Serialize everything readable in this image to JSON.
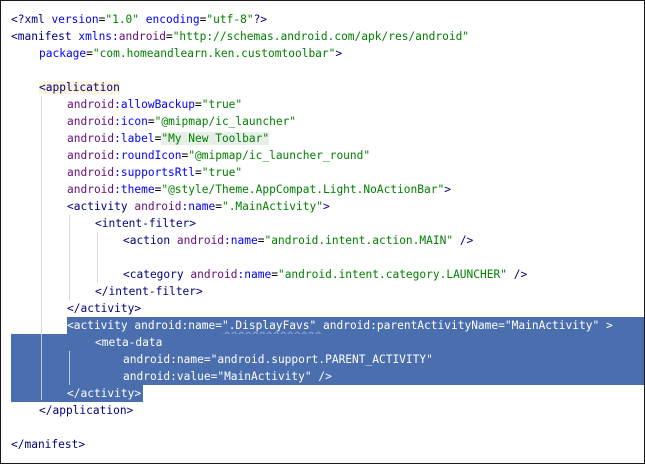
{
  "editor": {
    "lines": [
      {
        "id": "l1",
        "segments": [
          {
            "t": "<?",
            "c": "tag"
          },
          {
            "t": "xml ",
            "c": "tag"
          },
          {
            "t": "version",
            "c": "attr"
          },
          {
            "t": "=",
            "c": "plain"
          },
          {
            "t": "\"1.0\" ",
            "c": "val"
          },
          {
            "t": "encoding",
            "c": "attr"
          },
          {
            "t": "=",
            "c": "plain"
          },
          {
            "t": "\"utf-8\"",
            "c": "val"
          },
          {
            "t": "?>",
            "c": "tag"
          }
        ]
      },
      {
        "id": "l2",
        "segments": [
          {
            "t": "<manifest ",
            "c": "tag"
          },
          {
            "t": "xmlns:",
            "c": "attr"
          },
          {
            "t": "android",
            "c": "ns"
          },
          {
            "t": "=",
            "c": "plain"
          },
          {
            "t": "\"http://schemas.android.com/apk/res/android\"",
            "c": "val"
          }
        ]
      },
      {
        "id": "l3",
        "segments": [
          {
            "t": "package",
            "c": "attr"
          },
          {
            "t": "=",
            "c": "plain"
          },
          {
            "t": "\"com.homeandlearn.ken.customtoolbar\"",
            "c": "val"
          },
          {
            "t": ">",
            "c": "tag"
          }
        ]
      },
      {
        "id": "l4",
        "segments": []
      },
      {
        "id": "l5",
        "segments": [
          {
            "t": "<application",
            "c": "tag"
          }
        ]
      },
      {
        "id": "l6",
        "segments": [
          {
            "t": "android",
            "c": "ns"
          },
          {
            "t": ":allowBackup",
            "c": "attr"
          },
          {
            "t": "=",
            "c": "plain"
          },
          {
            "t": "\"true\"",
            "c": "val"
          }
        ]
      },
      {
        "id": "l7",
        "segments": [
          {
            "t": "android",
            "c": "ns"
          },
          {
            "t": ":icon",
            "c": "attr"
          },
          {
            "t": "=",
            "c": "plain"
          },
          {
            "t": "\"@mipmap/ic_launcher\"",
            "c": "val"
          }
        ]
      },
      {
        "id": "l8",
        "segments": [
          {
            "t": "android",
            "c": "ns"
          },
          {
            "t": ":label",
            "c": "attr"
          },
          {
            "t": "=",
            "c": "plain"
          },
          {
            "t": "\"My New Toolbar\"",
            "c": "val"
          }
        ]
      },
      {
        "id": "l9",
        "segments": [
          {
            "t": "android",
            "c": "ns"
          },
          {
            "t": ":roundIcon",
            "c": "attr"
          },
          {
            "t": "=",
            "c": "plain"
          },
          {
            "t": "\"@mipmap/ic_launcher_round\"",
            "c": "val"
          }
        ]
      },
      {
        "id": "l10",
        "segments": [
          {
            "t": "android",
            "c": "ns"
          },
          {
            "t": ":supportsRtl",
            "c": "attr"
          },
          {
            "t": "=",
            "c": "plain"
          },
          {
            "t": "\"true\"",
            "c": "val"
          }
        ]
      },
      {
        "id": "l11",
        "segments": [
          {
            "t": "android",
            "c": "ns"
          },
          {
            "t": ":theme",
            "c": "attr"
          },
          {
            "t": "=",
            "c": "plain"
          },
          {
            "t": "\"@style/Theme.AppCompat.Light.NoActionBar\"",
            "c": "val"
          },
          {
            "t": ">",
            "c": "tag"
          }
        ]
      },
      {
        "id": "l12",
        "segments": [
          {
            "t": "<activity ",
            "c": "tag"
          },
          {
            "t": "android",
            "c": "ns"
          },
          {
            "t": ":name",
            "c": "attr"
          },
          {
            "t": "=",
            "c": "plain"
          },
          {
            "t": "\".MainActivity\"",
            "c": "val"
          },
          {
            "t": ">",
            "c": "tag"
          }
        ]
      },
      {
        "id": "l13",
        "segments": [
          {
            "t": "<intent-filter>",
            "c": "tag"
          }
        ]
      },
      {
        "id": "l14",
        "segments": [
          {
            "t": "<action ",
            "c": "tag"
          },
          {
            "t": "android",
            "c": "ns"
          },
          {
            "t": ":name",
            "c": "attr"
          },
          {
            "t": "=",
            "c": "plain"
          },
          {
            "t": "\"android.intent.action.MAIN\" ",
            "c": "val"
          },
          {
            "t": "/>",
            "c": "tag"
          }
        ]
      },
      {
        "id": "l15",
        "segments": []
      },
      {
        "id": "l16",
        "segments": [
          {
            "t": "<category ",
            "c": "tag"
          },
          {
            "t": "android",
            "c": "ns"
          },
          {
            "t": ":name",
            "c": "attr"
          },
          {
            "t": "=",
            "c": "plain"
          },
          {
            "t": "\"android.intent.category.LAUNCHER\" ",
            "c": "val"
          },
          {
            "t": "/>",
            "c": "tag"
          }
        ]
      },
      {
        "id": "l17",
        "segments": [
          {
            "t": "</intent-filter>",
            "c": "tag"
          }
        ]
      },
      {
        "id": "l18",
        "segments": [
          {
            "t": "</activity>",
            "c": "tag"
          }
        ]
      },
      {
        "id": "l19",
        "segments": [
          {
            "t": "<activity ",
            "c": "tag"
          },
          {
            "t": "android",
            "c": "ns"
          },
          {
            "t": ":name",
            "c": "attr"
          },
          {
            "t": "=",
            "c": "plain"
          },
          {
            "t": "\".DisplayFavs\" ",
            "c": "val"
          },
          {
            "t": "android",
            "c": "ns"
          },
          {
            "t": ":parentActivityName",
            "c": "attr"
          },
          {
            "t": "=",
            "c": "plain"
          },
          {
            "t": "\"MainActivity\" ",
            "c": "val"
          },
          {
            "t": ">",
            "c": "tag"
          }
        ]
      },
      {
        "id": "l20",
        "segments": [
          {
            "t": "<meta-data",
            "c": "tag"
          }
        ]
      },
      {
        "id": "l21",
        "segments": [
          {
            "t": "android",
            "c": "ns"
          },
          {
            "t": ":name",
            "c": "attr"
          },
          {
            "t": "=",
            "c": "plain"
          },
          {
            "t": "\"android.support.PARENT_ACTIVITY\"",
            "c": "val"
          }
        ]
      },
      {
        "id": "l22",
        "segments": [
          {
            "t": "android",
            "c": "ns"
          },
          {
            "t": ":value",
            "c": "attr"
          },
          {
            "t": "=",
            "c": "plain"
          },
          {
            "t": "\"MainActivity\" ",
            "c": "val"
          },
          {
            "t": "/>",
            "c": "tag"
          }
        ]
      },
      {
        "id": "l23",
        "segments": [
          {
            "t": "</activity>",
            "c": "tag"
          }
        ]
      },
      {
        "id": "l24",
        "segments": [
          {
            "t": "</application>",
            "c": "tag"
          }
        ]
      },
      {
        "id": "l25",
        "segments": []
      },
      {
        "id": "l26",
        "segments": [
          {
            "t": "</manifest>",
            "c": "tag"
          }
        ]
      }
    ]
  },
  "colors": {
    "selection": "#4b6eaf",
    "tag": "#000080",
    "attribute": "#0000ff",
    "namespace": "#660e7a",
    "value": "#008000"
  }
}
